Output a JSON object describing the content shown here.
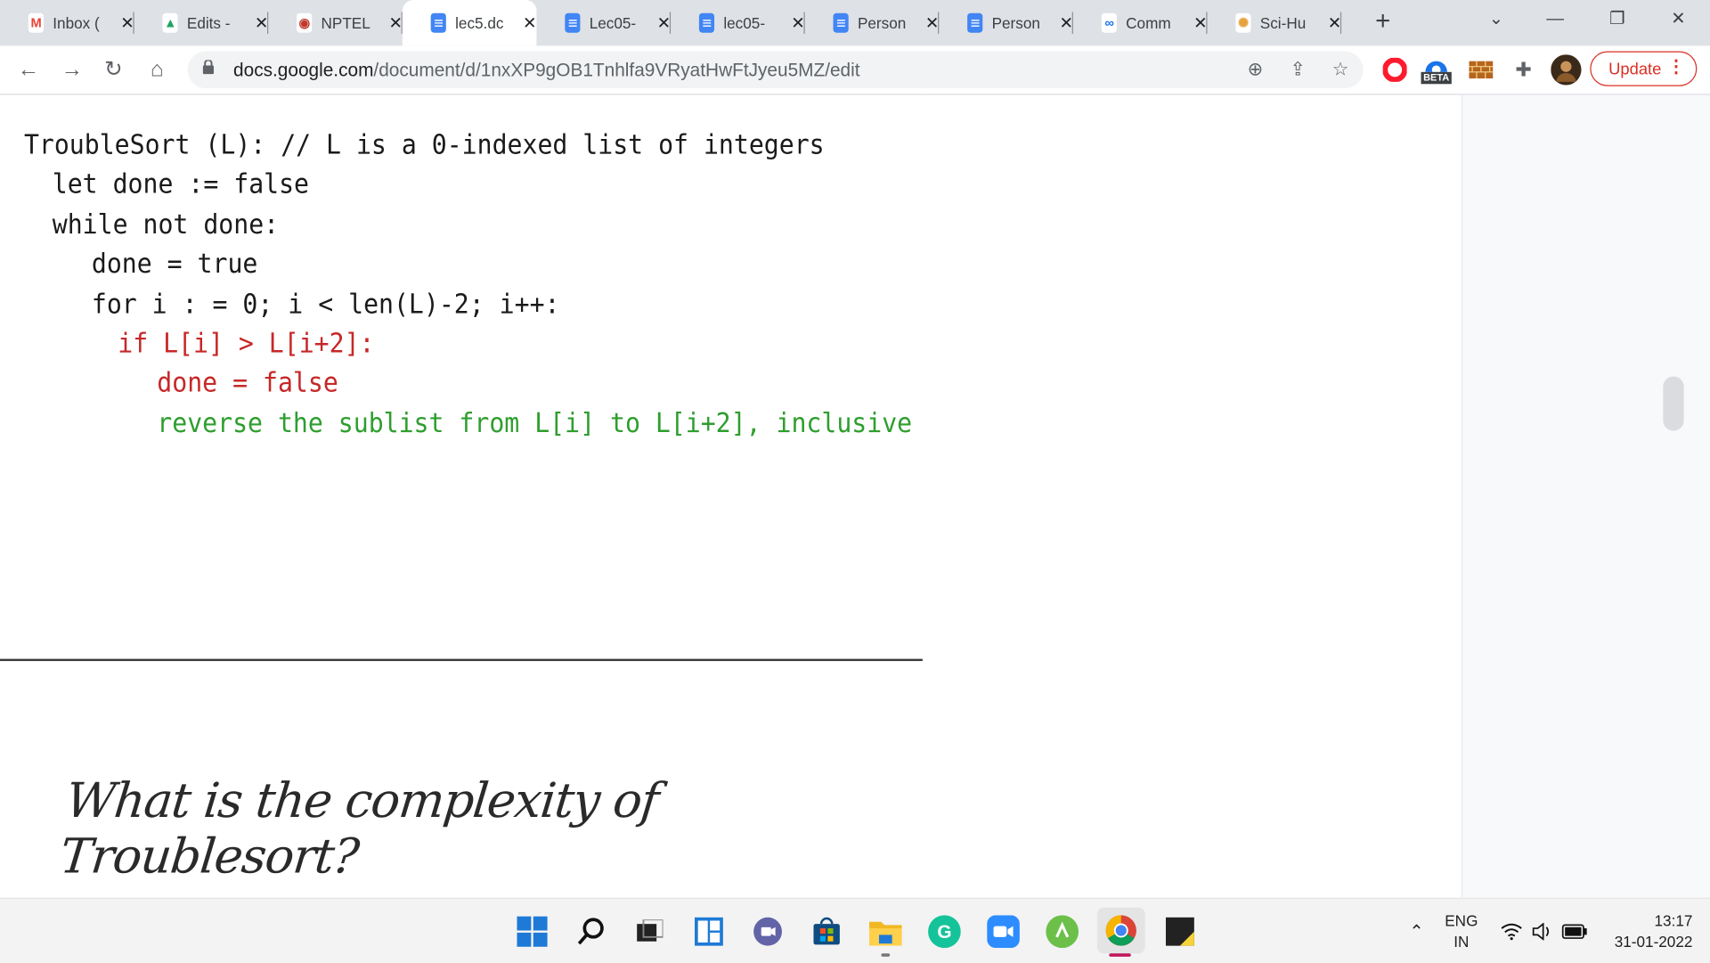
{
  "browser": {
    "tabs": [
      {
        "title": "Inbox (",
        "icon": "gmail-icon",
        "active": false
      },
      {
        "title": "Edits -",
        "icon": "google-drive-icon",
        "active": false
      },
      {
        "title": "NPTEL",
        "icon": "nptel-icon",
        "active": false
      },
      {
        "title": "lec5.dc",
        "icon": "google-docs-icon",
        "active": true
      },
      {
        "title": "Lec05-",
        "icon": "google-docs-icon",
        "active": false
      },
      {
        "title": "lec05-",
        "icon": "google-docs-icon",
        "active": false
      },
      {
        "title": "Person",
        "icon": "google-docs-icon",
        "active": false
      },
      {
        "title": "Person",
        "icon": "google-docs-icon",
        "active": false
      },
      {
        "title": "Comm",
        "icon": "link-icon",
        "active": false
      },
      {
        "title": "Sci-Hu",
        "icon": "sci-hub-icon",
        "active": false
      }
    ],
    "url_host": "docs.google.com",
    "url_path": "/document/d/1nxXP9gOB1Tnhlfa9VRyatHwFtJyeu5MZ/edit",
    "update_label": "Update",
    "beta_badge": "BETA"
  },
  "document": {
    "code_lines": [
      {
        "text": "TroubleSort (L): // L is a 0-indexed list of integers",
        "indent": 0,
        "color": "black"
      },
      {
        "text": "let done := false",
        "indent": 1,
        "color": "black"
      },
      {
        "text": "while not done:",
        "indent": 1,
        "color": "black"
      },
      {
        "text": "done = true",
        "indent": 2,
        "color": "black"
      },
      {
        "text": "for i : = 0; i < len(L)-2; i++:",
        "indent": 2,
        "color": "black"
      },
      {
        "text": "if L[i] > L[i+2]:",
        "indent": 3,
        "color": "red"
      },
      {
        "text": "done = false",
        "indent": 4,
        "color": "red"
      },
      {
        "text": "reverse the sublist from L[i] to L[i+2], inclusive",
        "indent": 4,
        "color": "green"
      }
    ],
    "handwritten_question": "What is the complexity of Troublesort?"
  },
  "colors": {
    "red_text": "#c62828",
    "green_text": "#2e9e2e",
    "accent_update": "#d93025"
  },
  "taskbar": {
    "icons": [
      "windows-start-icon",
      "search-icon",
      "task-view-icon",
      "widgets-icon",
      "teams-chat-icon",
      "microsoft-store-icon",
      "file-explorer-icon",
      "grammarly-icon",
      "zoom-icon",
      "app-green-icon",
      "chrome-icon",
      "sticky-notes-icon"
    ],
    "language_top": "ENG",
    "language_bottom": "IN",
    "time": "13:17",
    "date": "31-01-2022"
  }
}
